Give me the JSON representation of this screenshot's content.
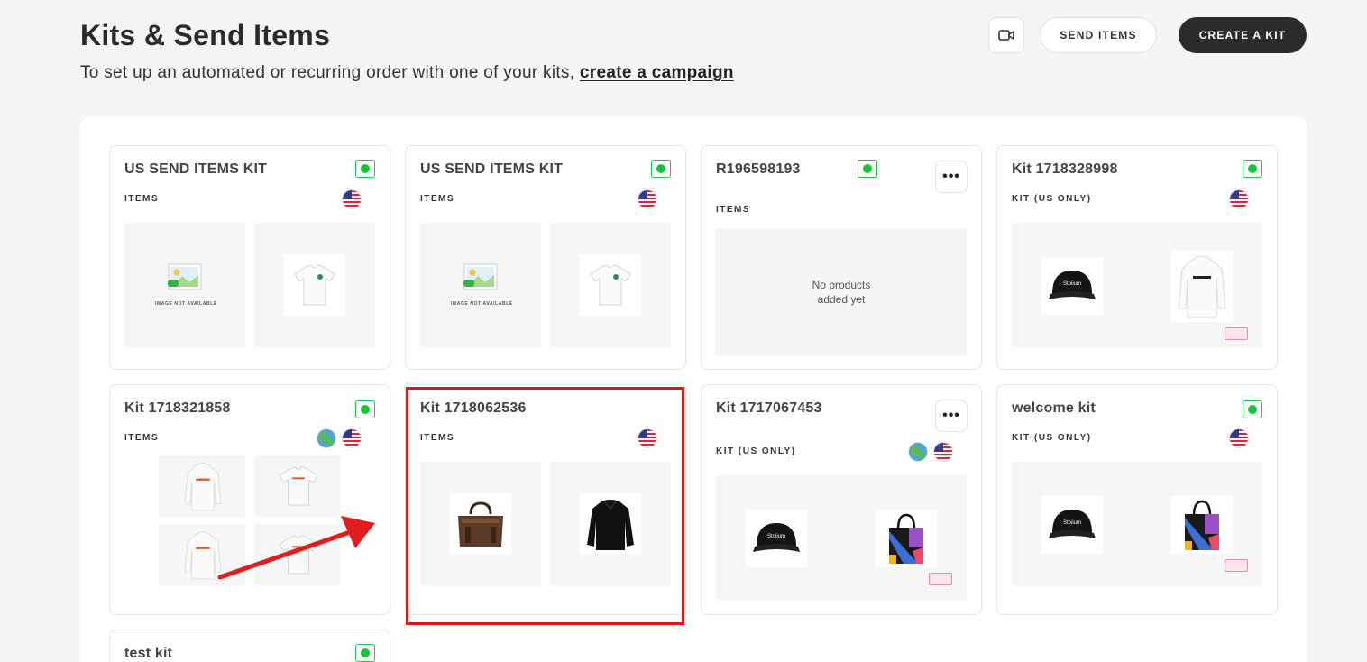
{
  "header": {
    "title": "Kits & Send Items",
    "subtitle_prefix": "To set up an automated or recurring order with one of your kits,",
    "subtitle_link": "create a campaign",
    "send_items_label": "SEND ITEMS",
    "create_kit_label": "CREATE A KIT",
    "video_icon": "video-camera-icon"
  },
  "kits": [
    {
      "name": "US SEND ITEMS KIT",
      "type": "ITEMS",
      "status": "active",
      "regions": [
        "us-flag"
      ],
      "products": [
        "image-not-available",
        "white-t-shirt"
      ]
    },
    {
      "name": "US SEND ITEMS KIT",
      "type": "ITEMS",
      "status": "active",
      "regions": [
        "us-flag"
      ],
      "products": [
        "image-not-available",
        "white-t-shirt"
      ]
    },
    {
      "name": "R196598193",
      "type": "ITEMS",
      "status": "active",
      "regions": [],
      "products": [],
      "empty_text": "No products added yet"
    },
    {
      "name": "Kit 1718328998",
      "type": "KIT (US ONLY)",
      "status": "active",
      "regions": [
        "us-flag"
      ],
      "products": [
        "black-cap",
        "white-hoodie"
      ]
    },
    {
      "name": "Kit 1718321858",
      "type": "ITEMS",
      "status": "active",
      "regions": [
        "globe",
        "us-flag"
      ],
      "products": [
        "white-hoodie",
        "white-t-shirt",
        "white-hoodie",
        "white-t-shirt"
      ]
    },
    {
      "name": "Kit 1718062536",
      "type": "ITEMS",
      "status": "none",
      "regions": [
        "us-flag"
      ],
      "products": [
        "brown-duffel-bag",
        "black-jacket"
      ]
    },
    {
      "name": "Kit 1717067453",
      "type": "KIT (US ONLY)",
      "status": "none",
      "regions": [
        "globe",
        "us-flag"
      ],
      "products": [
        "black-cap",
        "tote-bag"
      ]
    },
    {
      "name": "welcome kit",
      "type": "KIT (US ONLY)",
      "status": "active",
      "regions": [
        "us-flag"
      ],
      "products": [
        "black-cap",
        "tote-bag"
      ]
    },
    {
      "name": "test kit",
      "type": "",
      "status": "active",
      "regions": [],
      "products": []
    }
  ],
  "image_not_available_text": "IMAGE NOT AVAILABLE",
  "menu_glyph": "•••",
  "cap_logo_text": "Stoiium",
  "colors": {
    "accent_dark": "#2b2b2b",
    "status_green": "#17c439",
    "highlight_red": "#d31b1b",
    "arrow_red": "#e21d1d"
  }
}
